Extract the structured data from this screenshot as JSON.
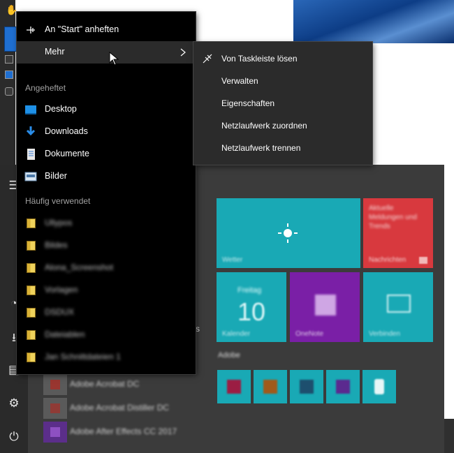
{
  "jump_list": {
    "pin_start": "An \"Start\" anheften",
    "more": "Mehr",
    "pinned_header": "Angeheftet",
    "pinned": [
      {
        "label": "Desktop",
        "icon": "desktop-icon"
      },
      {
        "label": "Downloads",
        "icon": "download-arrow-icon"
      },
      {
        "label": "Dokumente",
        "icon": "document-icon"
      },
      {
        "label": "Bilder",
        "icon": "pictures-icon"
      }
    ],
    "frequent_header": "Häufig verwendet",
    "frequent": [
      {
        "label": "Ullypos"
      },
      {
        "label": "Bildes"
      },
      {
        "label": "Alona_Screenshot"
      },
      {
        "label": "Vorlagen"
      },
      {
        "label": "DSDUX"
      },
      {
        "label": "Dateiablen"
      },
      {
        "label": "Jan Schnittdateien 1"
      }
    ]
  },
  "submenu": {
    "items": [
      {
        "label": "Von Taskleiste lösen",
        "icon": "unpin-icon"
      },
      {
        "label": "Verwalten",
        "icon": ""
      },
      {
        "label": "Eigenschaften",
        "icon": ""
      },
      {
        "label": "Netzlaufwerk zuordnen",
        "icon": ""
      },
      {
        "label": "Netzlaufwerk trennen",
        "icon": ""
      }
    ]
  },
  "start_menu": {
    "tiles": [
      {
        "label": "Wetter",
        "color": "#19a9b5"
      },
      {
        "label": "Nachrichten",
        "color": "#d8393e"
      },
      {
        "label": "Kalender",
        "color": "#19a9b5"
      },
      {
        "label": "OneNote",
        "color": "#7a1fa6"
      },
      {
        "label": "Verbinden",
        "color": "#19a9b5"
      }
    ],
    "calendar_day": "Freitag",
    "calendar_date": "10",
    "news_text": "Aktuelle Meldungen und Trends",
    "group_label": "Adobe",
    "apps": [
      {
        "label": "Adobe Acrobat DC"
      },
      {
        "label": "Adobe Acrobat Distiller DC"
      },
      {
        "label": "Adobe After Effects CC 2017"
      }
    ]
  },
  "colors": {
    "jump_bg": "#000000",
    "submenu_bg": "#2b2b2b",
    "start_bg": "#3b3b3b",
    "accent": "#19a9b5"
  }
}
